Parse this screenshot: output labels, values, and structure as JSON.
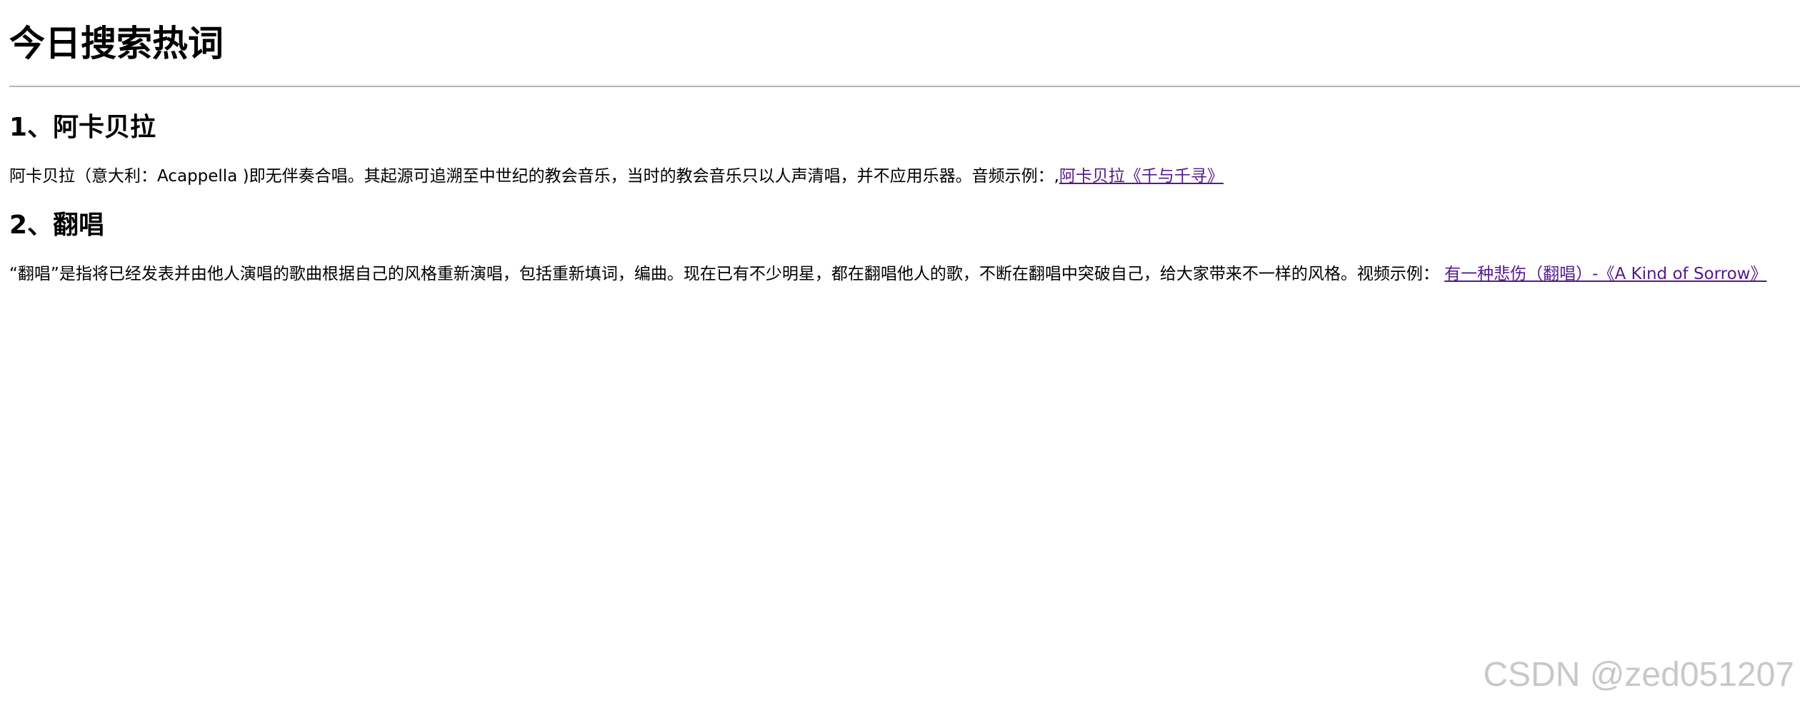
{
  "page": {
    "title": "今日搜索热词"
  },
  "sections": [
    {
      "heading": "1、阿卡贝拉",
      "text": "阿卡贝拉（意大利：Acappella )即无伴奏合唱。其起源可追溯至中世纪的教会音乐，当时的教会音乐只以人声清唱，并不应用乐器。音频示例：,",
      "link": "阿卡贝拉《千与千寻》"
    },
    {
      "heading": "2、翻唱",
      "text": "“翻唱”是指将已经发表并由他人演唱的歌曲根据自己的风格重新演唱，包括重新填词，编曲。现在已有不少明星，都在翻唱他人的歌，不断在翻唱中突破自己，给大家带来不一样的风格。视频示例： ",
      "link": "有一种悲伤（翻唱）-《A Kind of Sorrow》"
    }
  ],
  "watermark": "CSDN @zed051207",
  "colors": {
    "background": "#ffffff",
    "text": "#000000",
    "visited_link": "#551a8b",
    "rule": "#b4b4b4",
    "watermark": "#c8c8c8"
  }
}
